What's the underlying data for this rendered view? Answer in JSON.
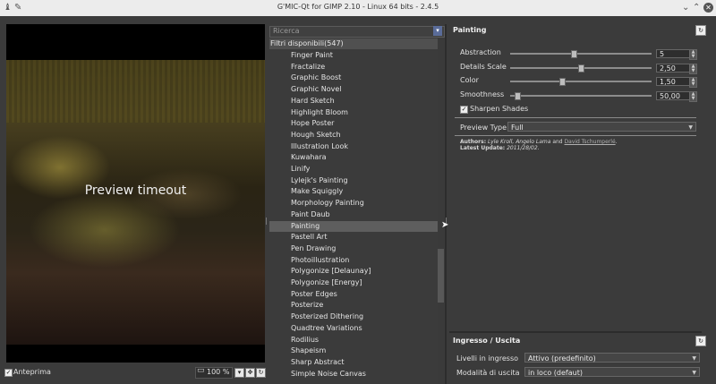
{
  "window": {
    "title": "G'MIC-Qt for GIMP 2.10 - Linux 64 bits - 2.4.5"
  },
  "preview": {
    "message": "Preview timeout",
    "anteprima_label": "Anteprima",
    "anteprima_checked": true,
    "zoom": "100 %"
  },
  "filters": {
    "search_placeholder": "Ricerca",
    "header": "Filtri disponibili(547)",
    "items": [
      "Finger Paint",
      "Fractalize",
      "Graphic Boost",
      "Graphic Novel",
      "Hard Sketch",
      "Highlight Bloom",
      "Hope Poster",
      "Hough Sketch",
      "Illustration Look",
      "Kuwahara",
      "Linify",
      "Lylejk's Painting",
      "Make Squiggly",
      "Morphology Painting",
      "Paint Daub",
      "Painting",
      "Pastell Art",
      "Pen Drawing",
      "Photoillustration",
      "Polygonize [Delaunay]",
      "Polygonize [Energy]",
      "Poster Edges",
      "Posterize",
      "Posterized Dithering",
      "Quadtree Variations",
      "Rodilius",
      "Shapeism",
      "Sharp Abstract",
      "Simple Noise Canvas"
    ],
    "selected": "Painting"
  },
  "params": {
    "title": "Painting",
    "sliders": [
      {
        "label": "Abstraction",
        "value": "5",
        "fraction": 0.45
      },
      {
        "label": "Details Scale",
        "value": "2,50",
        "fraction": 0.5
      },
      {
        "label": "Color",
        "value": "1,50",
        "fraction": 0.37
      },
      {
        "label": "Smoothness",
        "value": "50,00",
        "fraction": 0.05
      }
    ],
    "sharpen_label": "Sharpen Shades",
    "sharpen_checked": true,
    "preview_type_label": "Preview Type",
    "preview_type_value": "Full",
    "authors_prefix": "Authors:",
    "authors_names": "Lyle Kroll, Angelo Lama",
    "authors_and": "and",
    "authors_link": "David Tschumperlé",
    "authors_dot": ".",
    "latest_label": "Latest Update:",
    "latest_date": "2011/28/02."
  },
  "io": {
    "title": "Ingresso / Uscita",
    "input_label": "Livelli in ingresso",
    "input_value": "Attivo (predefinito)",
    "output_label": "Modalità di uscita",
    "output_value": "in loco (defaut)"
  }
}
